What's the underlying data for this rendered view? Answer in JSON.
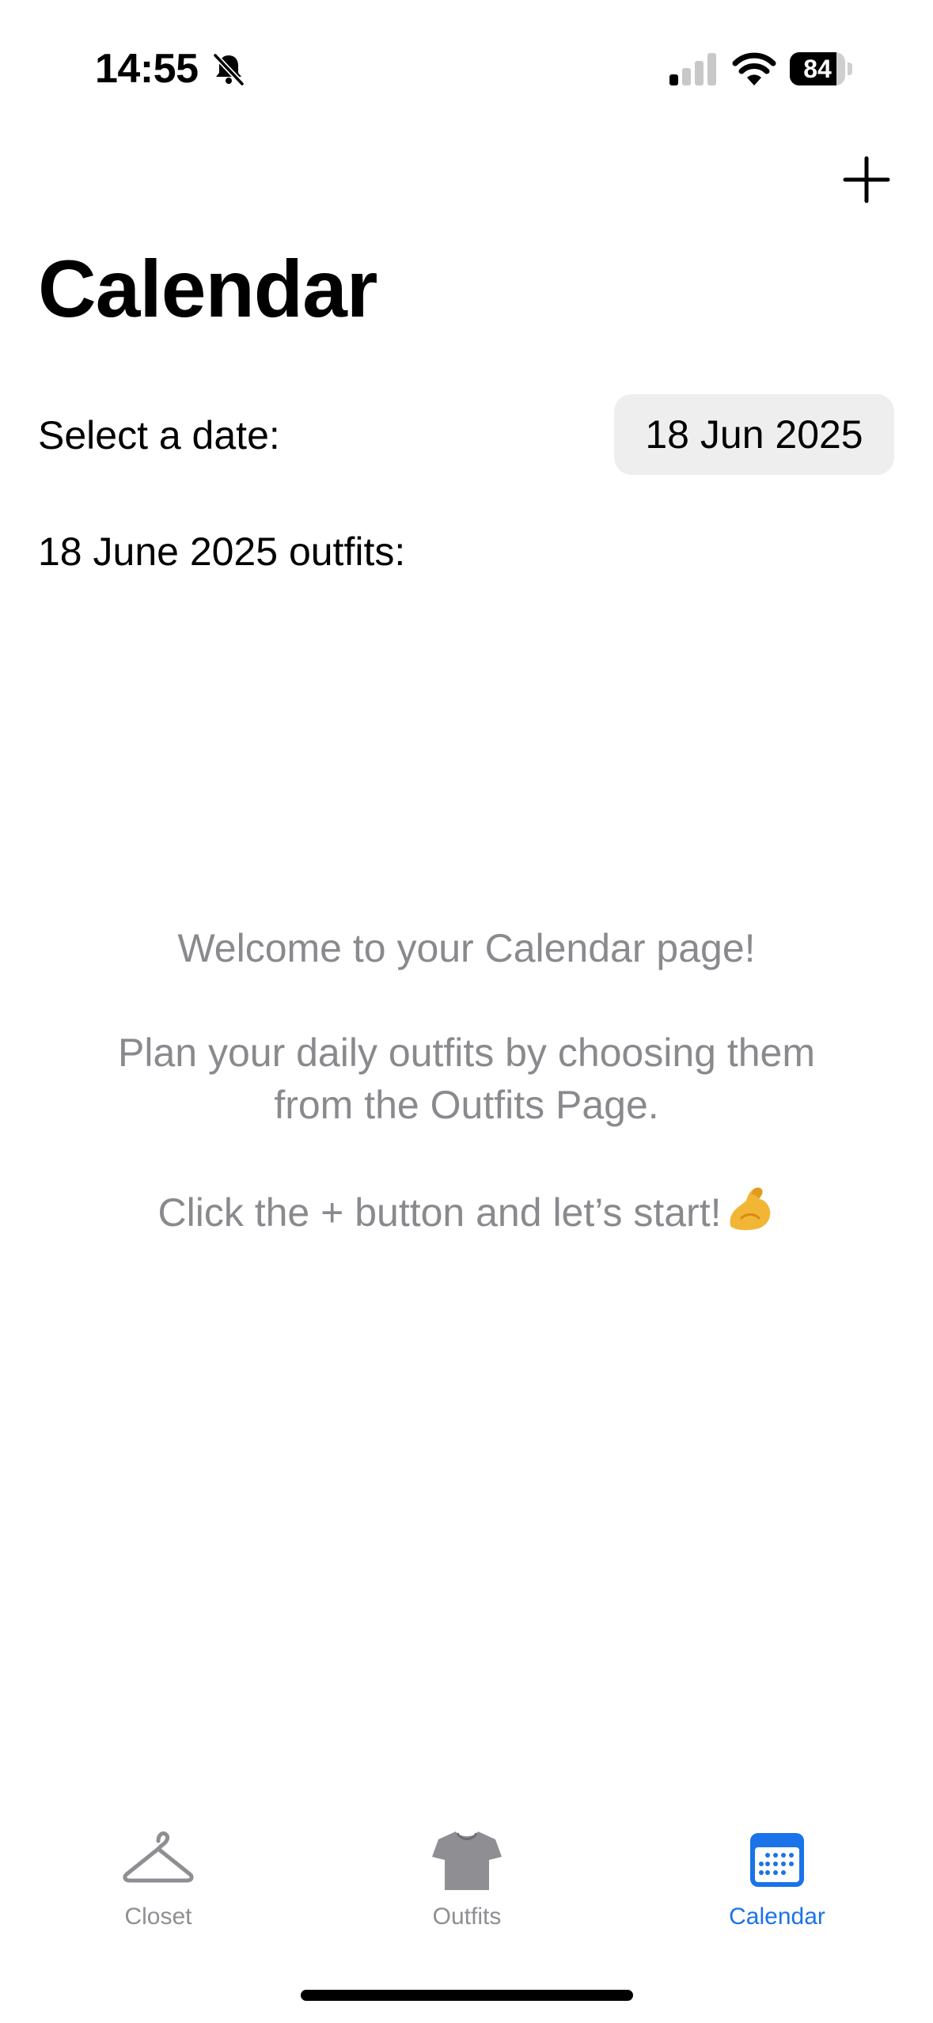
{
  "status_bar": {
    "time": "14:55",
    "battery_level": "84",
    "battery_fraction": 0.84,
    "icons": [
      "bell-slash-icon",
      "cellular-signal-icon",
      "wifi-icon",
      "battery-icon"
    ]
  },
  "nav": {
    "add_icon": "plus-icon",
    "title": "Calendar"
  },
  "date_row": {
    "label": "Select a date:",
    "selected_date": "18 Jun 2025"
  },
  "outfits_heading": "18 June 2025 outfits:",
  "empty_state": {
    "line1": "Welcome to your Calendar page!",
    "line2": "Plan your daily outfits by choosing them from the Outfits Page.",
    "line3": "Click the + button and let’s start!",
    "emoji": "flexed-biceps-icon"
  },
  "tab_bar": {
    "tabs": [
      {
        "label": "Closet",
        "icon": "hanger-icon",
        "active": false
      },
      {
        "label": "Outfits",
        "icon": "tshirt-icon",
        "active": false
      },
      {
        "label": "Calendar",
        "icon": "calendar-icon",
        "active": true
      }
    ]
  },
  "colors": {
    "accent": "#1a73e8",
    "inactive": "#8e8e93",
    "secondary_text": "#8a8a8e",
    "date_chip": "#eeeeef"
  }
}
